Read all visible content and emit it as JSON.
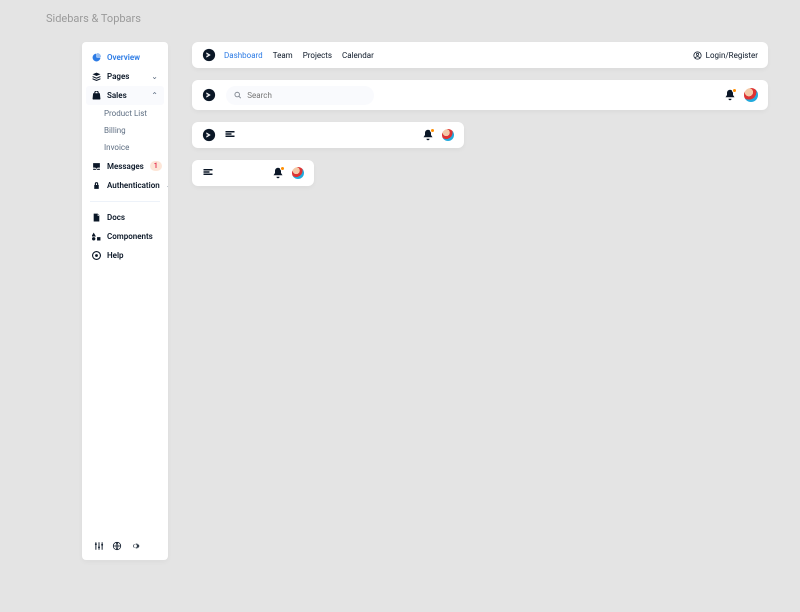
{
  "page": {
    "title": "Sidebars & Topbars"
  },
  "sidebar": {
    "items": {
      "overview": "Overview",
      "pages": "Pages",
      "sales": "Sales",
      "messages": "Messages",
      "auth": "Authentication",
      "docs": "Docs",
      "components": "Components",
      "help": "Help"
    },
    "sales_children": {
      "product_list": "Product List",
      "billing": "Billing",
      "invoice": "Invoice"
    },
    "messages_badge": "1"
  },
  "topbar1": {
    "links": {
      "dashboard": "Dashboard",
      "team": "Team",
      "projects": "Projects",
      "calendar": "Calendar"
    },
    "login": "Login/Register"
  },
  "topbar2": {
    "search_placeholder": "Search"
  }
}
